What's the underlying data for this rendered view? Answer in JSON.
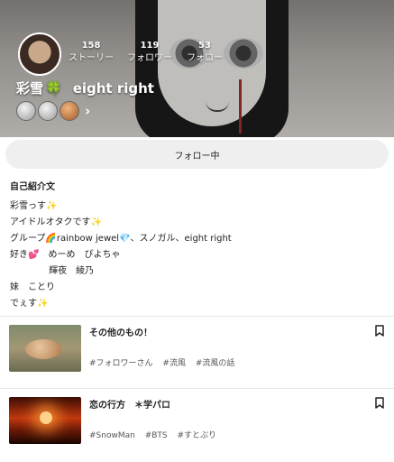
{
  "profile": {
    "stats": [
      {
        "num": "158",
        "label": "ストーリー"
      },
      {
        "num": "119",
        "label": "フォロワー"
      },
      {
        "num": "53",
        "label": "フォロー"
      }
    ],
    "name": "彩雪",
    "name_emoji": "🍀",
    "name_extra": "eight right",
    "medals": [
      "silver",
      "silver",
      "bronze"
    ]
  },
  "follow_button": "フォロー中",
  "bio": {
    "title": "自己紹介文",
    "text": "彩雪っす✨\nアイドルオタクです✨\nグループ🌈rainbow jewel💎、スノガル、eight right\n好き💕　めーめ　ぴよちゃ\n　　　　 輝夜　綾乃\n妹　ことり\nでぇす✨"
  },
  "articles": [
    {
      "title": "その他のもの！",
      "tags": [
        "#フォロワーさん",
        "#流風",
        "#流風の話"
      ]
    },
    {
      "title": "恋の行方　＊学パロ",
      "tags": [
        "#SnowMan",
        "#BTS",
        "#すとぷり"
      ]
    }
  ]
}
